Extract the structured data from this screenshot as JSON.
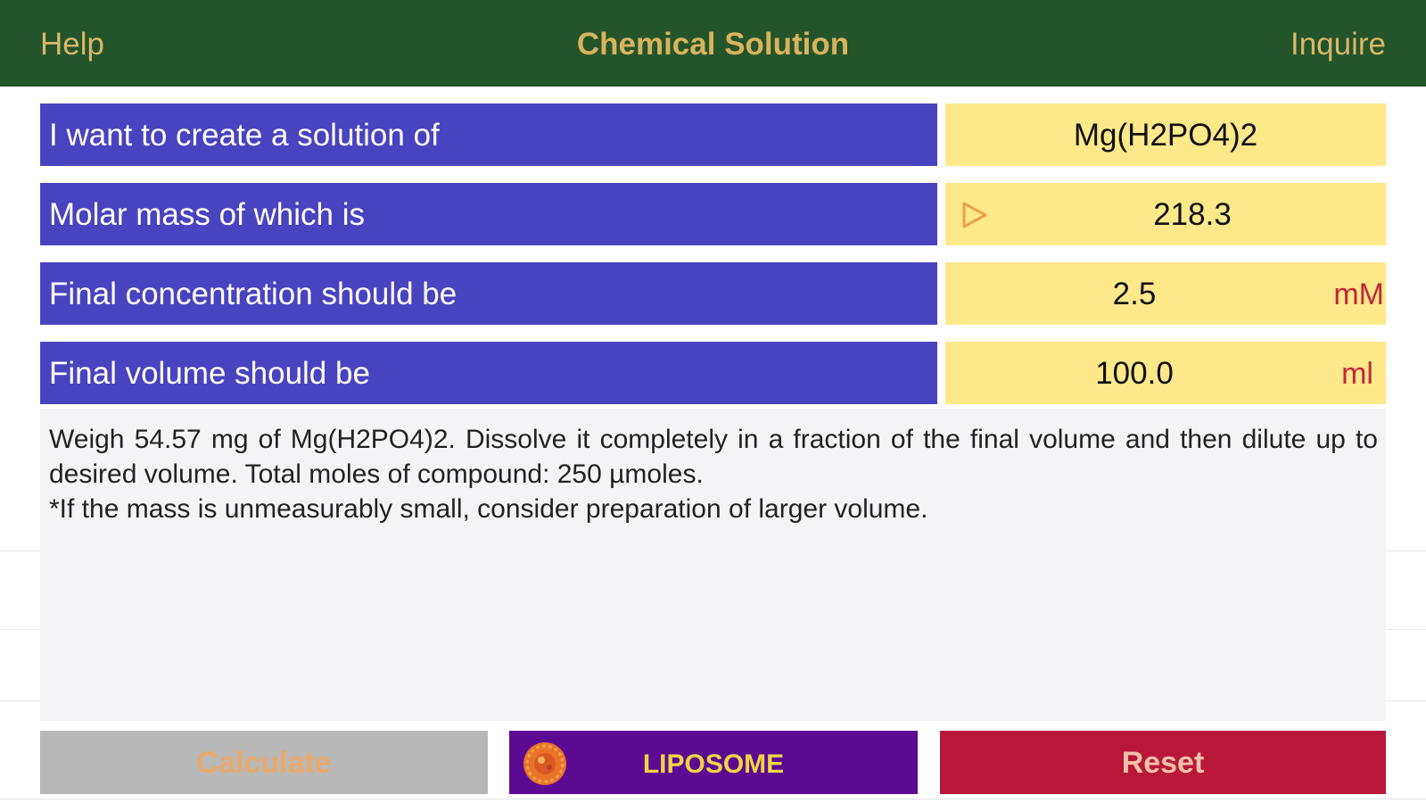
{
  "navbar": {
    "left_label": "Help",
    "title": "Chemical Solution",
    "right_label": "Inquire"
  },
  "form": {
    "rows": [
      {
        "label": "I want to create a solution of",
        "value": "Mg(H2PO4)2",
        "unit": ""
      },
      {
        "label": "Molar mass of which is",
        "value": "218.3",
        "unit": "",
        "icon": "play-triangle-icon"
      },
      {
        "label": "Final concentration should be",
        "value": "2.5",
        "unit": "mM"
      },
      {
        "label": "Final volume should be",
        "value": "100.0",
        "unit": "ml"
      }
    ]
  },
  "result": {
    "line1": "Weigh 54.57 mg of Mg(H2PO4)2. Dissolve it completely in a fraction of the final volume and then dilute up to desired volume. Total moles of compound: 250 µmoles.",
    "line2": "*If the mass is unmeasurably small, consider preparation of larger volume."
  },
  "buttons": {
    "calculate": "Calculate",
    "liposome": "LIPOSOME",
    "liposome_icon": "liposome-sphere-icon",
    "reset": "Reset"
  },
  "colors": {
    "navbar": "#24542a",
    "nav_text": "#d9b86a",
    "label_bg": "#4a43bf",
    "value_bg": "#fde88a",
    "unit_text": "#c1283a",
    "calculate_bg": "#b8b8b8",
    "liposome_bg": "#5d0a93",
    "reset_bg": "#b8173a"
  }
}
